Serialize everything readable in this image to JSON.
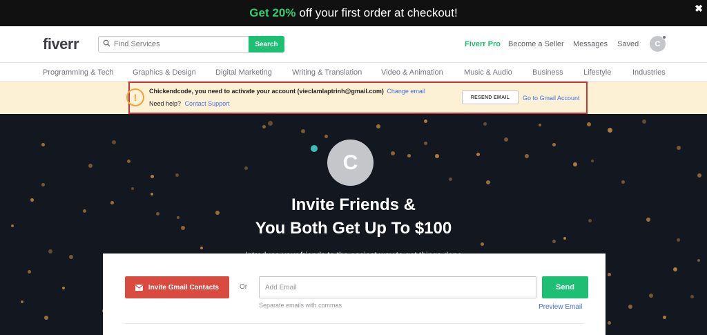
{
  "promo": {
    "highlight": "Get 20%",
    "text": "off your first order at checkout!",
    "close": "✖"
  },
  "header": {
    "logo": "fiverr",
    "search": {
      "placeholder": "Find Services",
      "button": "Search"
    },
    "nav": [
      "Fiverr Pro",
      "Become a Seller",
      "Messages",
      "Saved"
    ],
    "avatar_letter": "C"
  },
  "categories": [
    "Programming & Tech",
    "Graphics & Design",
    "Digital Marketing",
    "Writing & Translation",
    "Video & Animation",
    "Music & Audio",
    "Business",
    "Lifestyle",
    "Industries"
  ],
  "notice": {
    "icon": "!",
    "message": "Chickendcode, you need to activate your account (vieclamlaptrinh@gmail.com)",
    "change_email": "Change email",
    "help_text": "Need help?",
    "support_link": "Contact Support",
    "resend_button": "RESEND EMAIL",
    "gmail_link": "Go to Gmail Account"
  },
  "hero": {
    "avatar_letter": "C",
    "title_line1": "Invite Friends &",
    "title_line2": "You Both Get Up To $100",
    "subtitle": "Introduce your friends to the easiest way to get things done"
  },
  "invite": {
    "gmail_button": "Invite Gmail Contacts",
    "or": "Or",
    "email_placeholder": "Add Email",
    "send_button": "Send",
    "hint": "Separate emails with commas",
    "preview": "Preview Email"
  },
  "colors": {
    "brand_green": "#1dbf73",
    "gmail_red": "#d84b3e",
    "link_blue": "#446ee7",
    "warning_orange": "#f0a23b",
    "notice_bg": "#fdf1d5"
  }
}
